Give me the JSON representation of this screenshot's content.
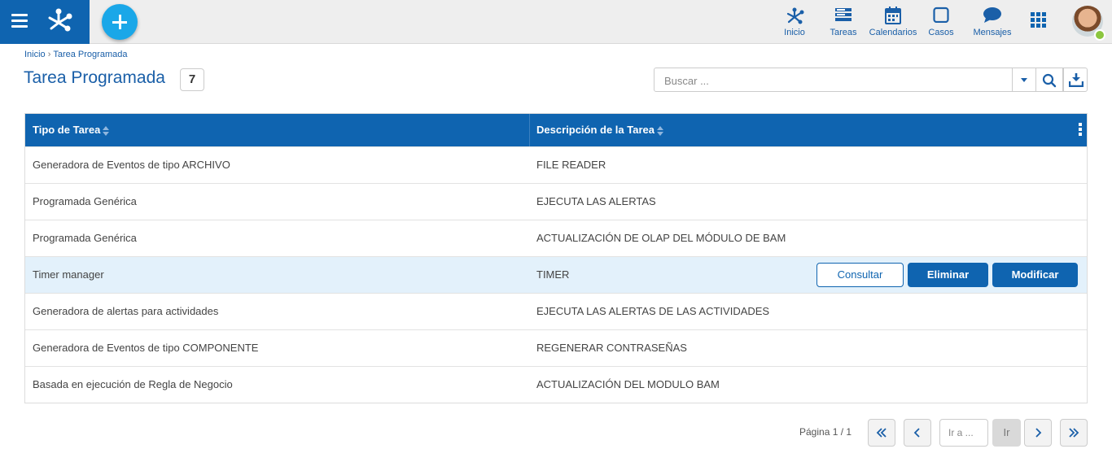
{
  "header": {
    "nav": [
      {
        "label": "Inicio",
        "icon": "process-icon"
      },
      {
        "label": "Tareas",
        "icon": "tasks-icon"
      },
      {
        "label": "Calendarios",
        "icon": "calendar-icon"
      },
      {
        "label": "Casos",
        "icon": "cases-icon"
      },
      {
        "label": "Mensajes",
        "icon": "messages-icon"
      }
    ]
  },
  "breadcrumb": {
    "home": "Inicio",
    "separator": "›",
    "current": "Tarea Programada"
  },
  "page": {
    "title": "Tarea Programada",
    "count": "7"
  },
  "search": {
    "placeholder": "Buscar ..."
  },
  "grid": {
    "columns": [
      "Tipo de Tarea",
      "Descripción de la Tarea"
    ],
    "rows": [
      {
        "tipo": "Generadora de Eventos de tipo ARCHIVO",
        "descripcion": "FILE READER"
      },
      {
        "tipo": "Programada Genérica",
        "descripcion": "EJECUTA LAS ALERTAS"
      },
      {
        "tipo": "Programada Genérica",
        "descripcion": "ACTUALIZACIÓN DE OLAP DEL MÓDULO DE BAM"
      },
      {
        "tipo": "Timer manager",
        "descripcion": "TIMER"
      },
      {
        "tipo": "Generadora de alertas para actividades",
        "descripcion": "EJECUTA LAS ALERTAS DE LAS ACTIVIDADES"
      },
      {
        "tipo": "Generadora de Eventos de tipo COMPONENTE",
        "descripcion": "REGENERAR CONTRASEÑAS"
      },
      {
        "tipo": "Basada en ejecución de Regla de Negocio",
        "descripcion": "ACTUALIZACIÓN DEL MODULO BAM"
      }
    ],
    "selected_row_actions": {
      "consultar": "Consultar",
      "eliminar": "Eliminar",
      "modificar": "Modificar"
    }
  },
  "pager": {
    "label": "Página 1 / 1",
    "goto_placeholder": "Ir a ...",
    "go": "Ir"
  },
  "colors": {
    "primary": "#0f64b0",
    "accent": "#1aa7e8",
    "selected_row": "#e3f1fb",
    "presence": "#8cc63f"
  }
}
